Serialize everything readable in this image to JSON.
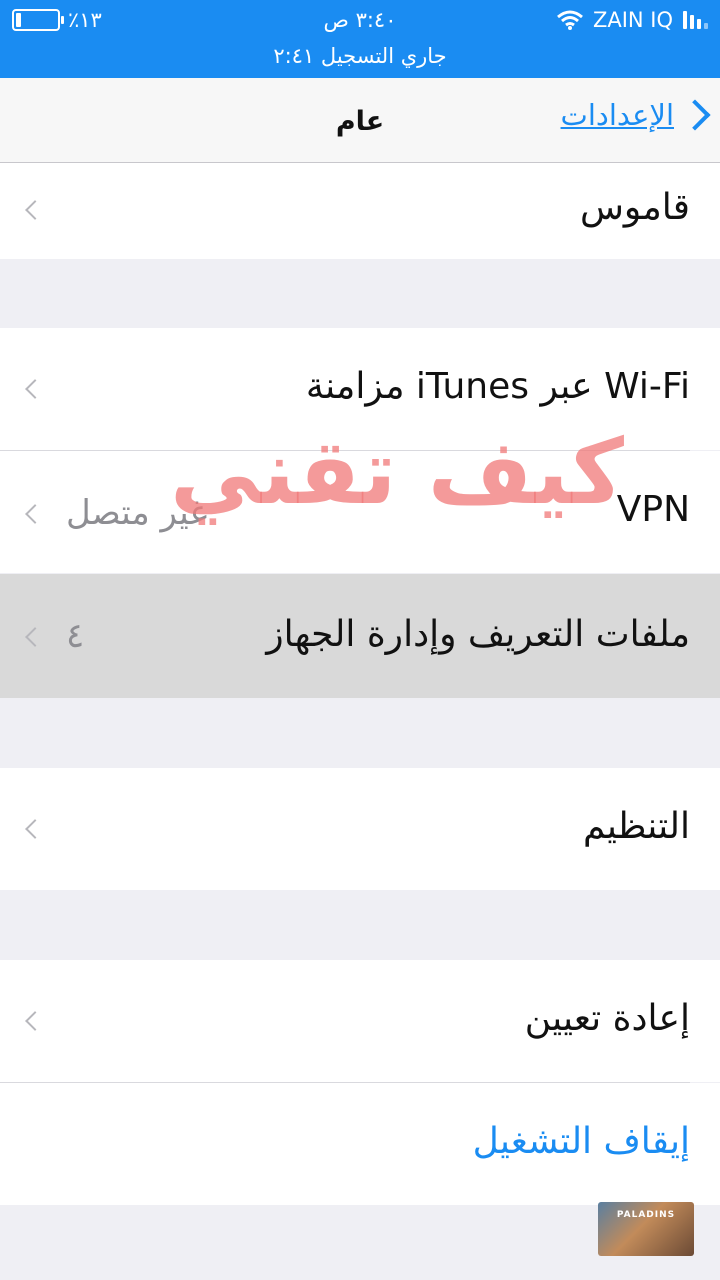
{
  "status_bar": {
    "battery": "٪١٣",
    "time": "٣:٤٠ ص",
    "carrier": "ZAIN IQ",
    "recording": "جاري التسجيل ٢:٤١"
  },
  "nav": {
    "back_label": "الإعدادات",
    "title": "عام"
  },
  "rows": {
    "dictionary": "قاموس",
    "itunes_wifi": "مزامنة iTunes عبر Wi-Fi",
    "vpn": "VPN",
    "vpn_status": "غير متصل",
    "profiles": "ملفات التعريف وإدارة الجهاز",
    "profiles_count": "٤",
    "regulatory": "التنظيم",
    "reset": "إعادة تعيين",
    "shutdown": "إيقاف التشغيل"
  },
  "overlay": {
    "watermark": "كيف تقني",
    "game_logo": "PALADINS"
  },
  "colors": {
    "accent": "#1a8cf2",
    "watermark": "#f07878",
    "highlight": "#d9d9d9"
  }
}
